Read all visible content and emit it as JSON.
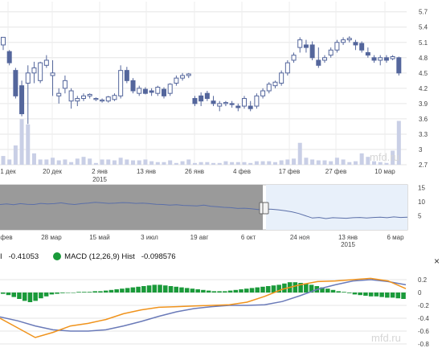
{
  "chart_data": [
    {
      "type": "candlestick",
      "title": "",
      "y_ticks": [
        "5.7",
        "5.4",
        "5.1",
        "4.8",
        "4.5",
        "4.2",
        "3.9",
        "3.6",
        "3.3",
        "3",
        "2.7"
      ],
      "ylim": [
        2.7,
        5.9
      ],
      "x_tick_labels": [
        "1 дек",
        "20 дек",
        "2 янв",
        "13 янв",
        "26 янв",
        "4 фев",
        "17 фев",
        "27 фев",
        "10 мар"
      ],
      "x_year_label": "2015",
      "candles": [
        [
          5.05,
          5.2,
          4.95,
          5.2
        ],
        [
          4.92,
          4.95,
          4.65,
          4.7
        ],
        [
          4.55,
          4.6,
          4.0,
          4.05
        ],
        [
          4.25,
          4.35,
          3.65,
          3.7
        ],
        [
          4.3,
          4.65,
          3.5,
          4.5
        ],
        [
          4.5,
          4.72,
          4.3,
          4.6
        ],
        [
          4.35,
          4.72,
          4.3,
          4.7
        ],
        [
          4.65,
          4.85,
          4.6,
          4.75
        ],
        [
          4.45,
          4.75,
          4.05,
          4.5
        ],
        [
          4.05,
          4.2,
          3.9,
          4.1
        ],
        [
          4.2,
          4.45,
          4.1,
          4.35
        ],
        [
          3.95,
          4.2,
          3.8,
          4.15
        ],
        [
          3.95,
          4.05,
          3.85,
          4.0
        ],
        [
          4.0,
          4.1,
          3.95,
          4.05
        ],
        [
          4.05,
          4.1,
          4.0,
          4.08
        ],
        [
          3.98,
          4.02,
          3.95,
          4.0
        ],
        [
          3.95,
          4.0,
          3.92,
          3.97
        ],
        [
          3.95,
          4.05,
          3.92,
          4.03
        ],
        [
          3.98,
          4.1,
          3.95,
          4.06
        ],
        [
          4.05,
          4.65,
          4.0,
          4.55
        ],
        [
          4.55,
          4.62,
          4.3,
          4.35
        ],
        [
          4.35,
          4.4,
          4.1,
          4.15
        ],
        [
          4.1,
          4.25,
          4.05,
          4.2
        ],
        [
          4.18,
          4.22,
          4.08,
          4.1
        ],
        [
          4.15,
          4.2,
          4.05,
          4.12
        ],
        [
          4.1,
          4.25,
          4.05,
          4.22
        ],
        [
          4.18,
          4.22,
          4.0,
          4.05
        ],
        [
          4.1,
          4.3,
          4.05,
          4.28
        ],
        [
          4.3,
          4.45,
          4.25,
          4.4
        ],
        [
          4.4,
          4.5,
          4.35,
          4.45
        ],
        [
          4.45,
          4.5,
          4.4,
          4.48
        ],
        [
          4.0,
          4.05,
          3.85,
          3.9
        ],
        [
          4.05,
          4.12,
          3.85,
          3.95
        ],
        [
          4.1,
          4.15,
          3.95,
          4.0
        ],
        [
          3.95,
          4.05,
          3.85,
          3.9
        ],
        [
          3.85,
          3.95,
          3.75,
          3.9
        ],
        [
          3.9,
          3.95,
          3.85,
          3.92
        ],
        [
          3.9,
          3.95,
          3.82,
          3.88
        ],
        [
          3.85,
          3.9,
          3.75,
          3.82
        ],
        [
          3.85,
          4.05,
          3.8,
          4.0
        ],
        [
          3.85,
          3.95,
          3.75,
          3.8
        ],
        [
          3.85,
          4.1,
          3.8,
          4.05
        ],
        [
          4.05,
          4.2,
          4.0,
          4.15
        ],
        [
          4.15,
          4.32,
          4.1,
          4.28
        ],
        [
          4.25,
          4.35,
          4.2,
          4.32
        ],
        [
          4.3,
          4.55,
          4.25,
          4.5
        ],
        [
          4.5,
          4.75,
          4.45,
          4.7
        ],
        [
          4.75,
          4.9,
          4.7,
          4.85
        ],
        [
          5.0,
          5.2,
          4.9,
          5.15
        ],
        [
          5.05,
          5.15,
          4.9,
          5.0
        ],
        [
          5.05,
          5.12,
          4.75,
          4.8
        ],
        [
          4.75,
          5.0,
          4.6,
          4.65
        ],
        [
          4.75,
          4.85,
          4.7,
          4.8
        ],
        [
          4.85,
          5.0,
          4.8,
          4.95
        ],
        [
          4.95,
          5.15,
          4.9,
          5.1
        ],
        [
          5.1,
          5.2,
          5.05,
          5.15
        ],
        [
          5.15,
          5.22,
          5.1,
          5.18
        ],
        [
          5.1,
          5.15,
          4.95,
          5.05
        ],
        [
          5.08,
          5.12,
          4.9,
          4.95
        ],
        [
          4.9,
          5.0,
          4.8,
          4.85
        ],
        [
          4.8,
          4.85,
          4.7,
          4.75
        ],
        [
          4.75,
          4.85,
          4.65,
          4.8
        ],
        [
          4.8,
          4.85,
          4.7,
          4.75
        ],
        [
          4.78,
          4.85,
          4.75,
          4.82
        ],
        [
          4.8,
          4.82,
          4.45,
          4.5
        ]
      ],
      "volume": [
        1,
        0.6,
        2.2,
        5.2,
        4.6,
        1.3,
        0.6,
        0.6,
        0.8,
        0.5,
        0.6,
        0.3,
        0.7,
        0.9,
        0.7,
        0.2,
        0.6,
        0.6,
        0.5,
        0.8,
        0.6,
        0.5,
        0.5,
        0.6,
        0.4,
        0.3,
        0.3,
        0.5,
        0.2,
        0.4,
        0.6,
        0.2,
        0.3,
        0.3,
        0.2,
        0.2,
        0.4,
        0.3,
        0.3,
        0.3,
        0.2,
        0.4,
        0.4,
        0.4,
        0.3,
        0.5,
        0.6,
        0.7,
        2.5,
        0.8,
        0.6,
        0.5,
        0.5,
        0.4,
        0.8,
        0.6,
        0.3,
        0.4,
        1.3,
        0.9,
        0.4,
        0.3,
        0.2,
        1.6,
        5.0
      ],
      "watermark": "mfd.ru"
    },
    {
      "type": "line",
      "role": "navigator",
      "y_ticks": [
        "15",
        "10",
        "5"
      ],
      "x_tick_labels": [
        "фев",
        "28 мар",
        "15 май",
        "3 июл",
        "19 авг",
        "6 окт",
        "24 ноя",
        "13 янв",
        "6 мар"
      ],
      "x_year_label": "2015",
      "series": [
        {
          "values": [
            9.0,
            9.2,
            8.9,
            9.3,
            9.1,
            9.0,
            9.4,
            9.2,
            9.3,
            9.6,
            9.2,
            9.0,
            9.3,
            9.5,
            9.8,
            9.6,
            9.4,
            9.5,
            9.7,
            9.6,
            9.4,
            9.5,
            9.3,
            9.1,
            9.0,
            8.8,
            8.9,
            8.7,
            8.6,
            8.5,
            8.8,
            8.4,
            8.2,
            8.0,
            7.9,
            7.6,
            7.7,
            7.5,
            7.2,
            7.4,
            7.3,
            7.1,
            6.8,
            6.4,
            5.8,
            5.0,
            4.2,
            4.4,
            4.0,
            4.3,
            4.2,
            4.1,
            4.3,
            4.4,
            4.2,
            4.4,
            4.5,
            4.3,
            4.6,
            4.4,
            4.5
          ]
        }
      ]
    },
    {
      "type": "macd",
      "legend_prefix": "I",
      "legend_value_1": "-0.41053",
      "legend_label": "MACD (12,26,9) Hist",
      "legend_value_2": "-0.098576",
      "y_ticks": [
        "0.2",
        "0",
        "-0.2",
        "-0.4",
        "-0.6",
        "-0.8"
      ],
      "ylim": [
        -0.85,
        0.3
      ],
      "watermark": "mfd.ru",
      "hist": [
        -0.02,
        -0.04,
        -0.07,
        -0.1,
        -0.13,
        -0.15,
        -0.13,
        -0.09,
        -0.06,
        -0.03,
        -0.02,
        -0.01,
        0.0,
        0.0,
        0.01,
        0.01,
        0.01,
        0.02,
        0.02,
        0.03,
        0.04,
        0.05,
        0.06,
        0.07,
        0.08,
        0.09,
        0.1,
        0.11,
        0.12,
        0.12,
        0.11,
        0.1,
        0.09,
        0.08,
        0.07,
        0.06,
        0.05,
        0.04,
        0.03,
        0.02,
        0.02,
        0.02,
        0.03,
        0.04,
        0.05,
        0.06,
        0.07,
        0.08,
        0.09,
        0.1,
        0.11,
        0.12,
        0.14,
        0.16,
        0.16,
        0.15,
        0.14,
        0.12,
        0.1,
        0.08,
        0.06,
        0.04,
        0.02,
        0.01,
        -0.01,
        -0.03,
        -0.04,
        -0.05,
        -0.06,
        -0.06,
        -0.07,
        -0.08,
        -0.08,
        -0.09,
        -0.1
      ],
      "series": [
        {
          "name": "Signal",
          "color": "#6a7ab8",
          "values": [
            -0.38,
            -0.44,
            -0.52,
            -0.58,
            -0.6,
            -0.6,
            -0.58,
            -0.52,
            -0.45,
            -0.37,
            -0.3,
            -0.25,
            -0.22,
            -0.2,
            -0.2,
            -0.19,
            -0.14,
            -0.05,
            0.05,
            0.12,
            0.18,
            0.2,
            0.17,
            0.12
          ]
        },
        {
          "name": "MACD",
          "color": "#f0931c",
          "values": [
            -0.4,
            -0.55,
            -0.7,
            -0.62,
            -0.52,
            -0.48,
            -0.42,
            -0.33,
            -0.27,
            -0.23,
            -0.22,
            -0.21,
            -0.2,
            -0.19,
            -0.15,
            -0.06,
            0.05,
            0.12,
            0.17,
            0.18,
            0.2,
            0.22,
            0.18,
            0.06
          ]
        }
      ]
    }
  ]
}
